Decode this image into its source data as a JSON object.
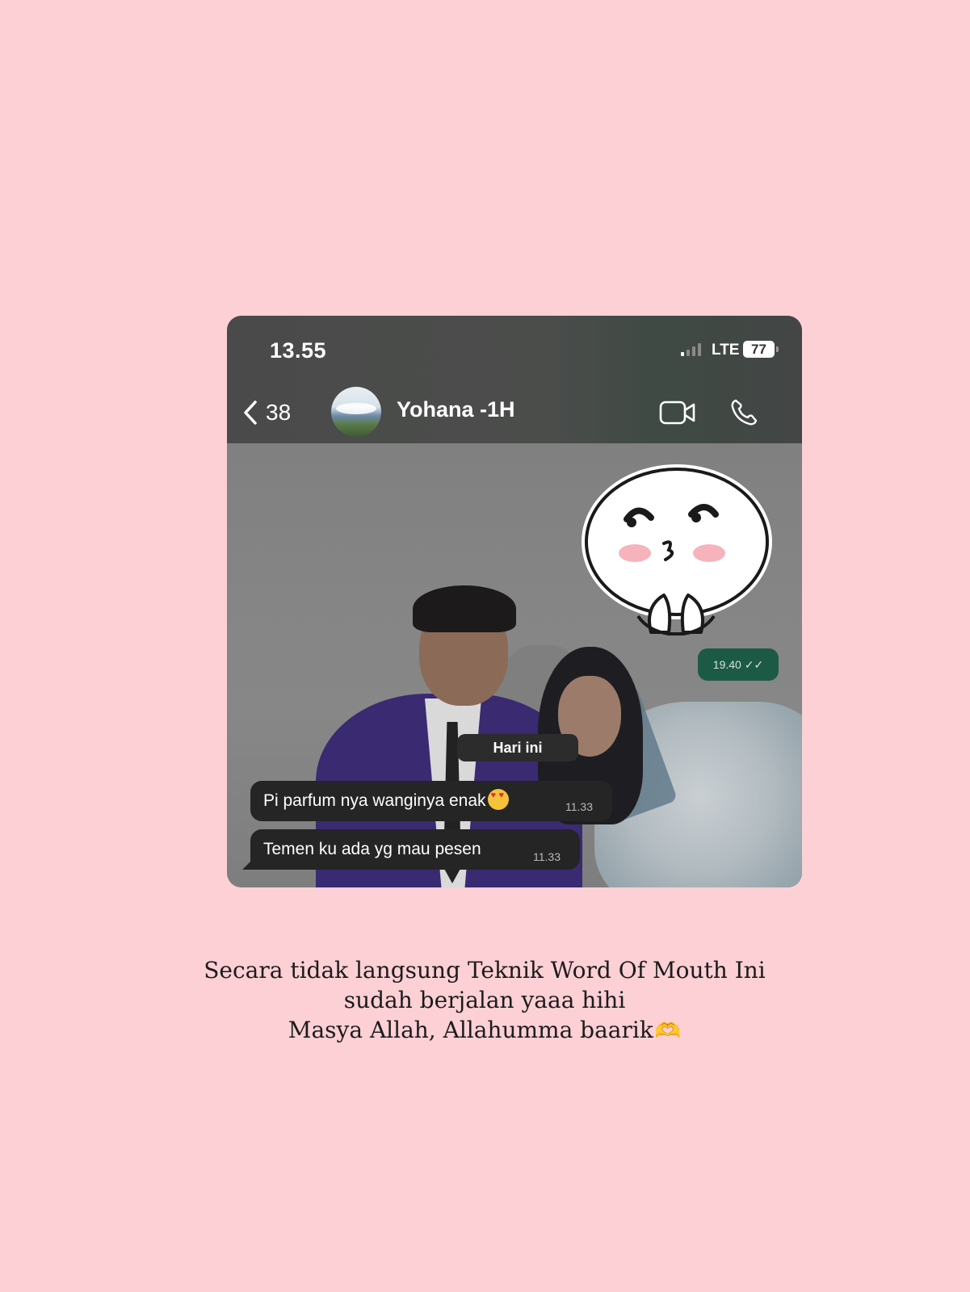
{
  "status_bar": {
    "time": "13.55",
    "network": "LTE",
    "battery": "77"
  },
  "chat_header": {
    "back_count": "38",
    "contact_name": "Yohana -1H",
    "icons": [
      "chevron-left-icon",
      "video-camera-icon",
      "phone-icon"
    ]
  },
  "messages": {
    "sticker_time": "19.40",
    "date_chip": "Hari ini",
    "incoming": [
      {
        "text": "Pi parfum nya wanginya enak",
        "emoji": "heart-eyes",
        "time": "11.33"
      },
      {
        "text": "Temen ku ada yg mau pesen",
        "time": "11.33"
      }
    ]
  },
  "caption": {
    "line1": "Secara tidak langsung Teknik Word Of Mouth Ini",
    "line2": "sudah berjalan yaaa hihi",
    "line3": "Masya Allah, Allahumma baarik"
  },
  "colors": {
    "background": "#fdd0d5",
    "header": "#4a4a4a",
    "outgoing_bubble": "#1d5a45",
    "incoming_bubble": "#252525"
  }
}
